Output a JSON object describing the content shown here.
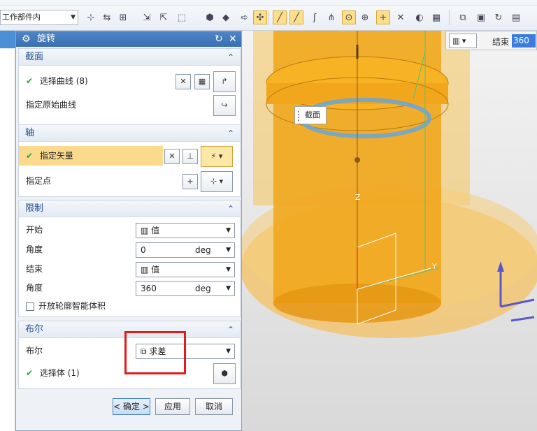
{
  "toolbar": {
    "scope_value": "工作部件内",
    "icons": [
      "select-filter-icon",
      "snap-icon",
      "feature-icon",
      "link-icon",
      "transform-icon",
      "box-select-icon",
      "cube-icon",
      "arrow-icon",
      "point-icon",
      "line-icon",
      "line-icon-2",
      "curve-icon",
      "arc-icon",
      "circle-center-icon",
      "circle-icon",
      "crosshair-icon",
      "target-icon",
      "shade-icon",
      "grid-icon",
      "view-icon",
      "image-icon",
      "refresh-icon",
      "layout-icon"
    ]
  },
  "dialog": {
    "title": "旋转",
    "sections": {
      "section": {
        "header": "截面",
        "select_curve": "选择曲线 (8)",
        "origin_curve": "指定原始曲线"
      },
      "axis": {
        "header": "轴",
        "vector": "指定矢量",
        "point": "指定点"
      },
      "limits": {
        "header": "限制",
        "start_label": "开始",
        "start_value": "值",
        "start_angle_label": "角度",
        "start_angle": "0",
        "unit": "deg",
        "end_label": "结束",
        "end_value": "值",
        "end_angle_label": "角度",
        "end_angle": "360",
        "open_profile": "开放轮廓智能体积"
      },
      "boolean": {
        "header": "布尔",
        "label": "布尔",
        "value": "求差",
        "select_body": "选择体 (1)"
      }
    },
    "buttons": {
      "ok": "< 确定 >",
      "apply": "应用",
      "cancel": "取消"
    }
  },
  "viewport": {
    "section_tag": "截面",
    "end_pad_label": "结束",
    "end_pad_value": "360",
    "axis_z": "Z",
    "axis_y": "Y"
  }
}
